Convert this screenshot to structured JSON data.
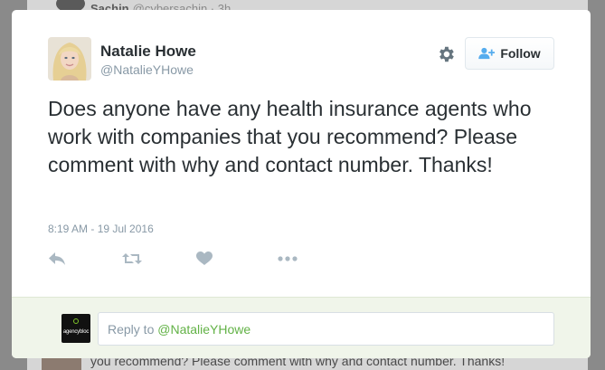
{
  "background": {
    "top_name": "Sachin",
    "top_handle": "@cybersachin · 3h",
    "bottom_text": "you recommend? Please comment with why and contact number. Thanks!"
  },
  "tweet": {
    "author_name": "Natalie Howe",
    "author_handle": "@NatalieYHowe",
    "text": "Does anyone have any health insurance agents who work with companies that you recommend? Please comment with why and contact number. Thanks!",
    "timestamp": "8:19 AM - 19 Jul 2016"
  },
  "header": {
    "follow_label": "Follow",
    "settings_icon": "gear-icon",
    "follow_icon": "add-user-icon"
  },
  "actions": [
    {
      "name": "reply",
      "icon": "reply-icon"
    },
    {
      "name": "retweet",
      "icon": "retweet-icon"
    },
    {
      "name": "like",
      "icon": "heart-icon"
    },
    {
      "name": "more",
      "icon": "more-icon"
    }
  ],
  "reply": {
    "prefix": "Reply to ",
    "mention": "@NatalieYHowe",
    "avatar_brand": "agencybloc"
  },
  "colors": {
    "text": "#292f33",
    "muted": "#8899a6",
    "icon": "#aab8c2",
    "reply_bar": "#f0f5ea",
    "mention": "#62b246",
    "follow_icon": "#55acee"
  }
}
